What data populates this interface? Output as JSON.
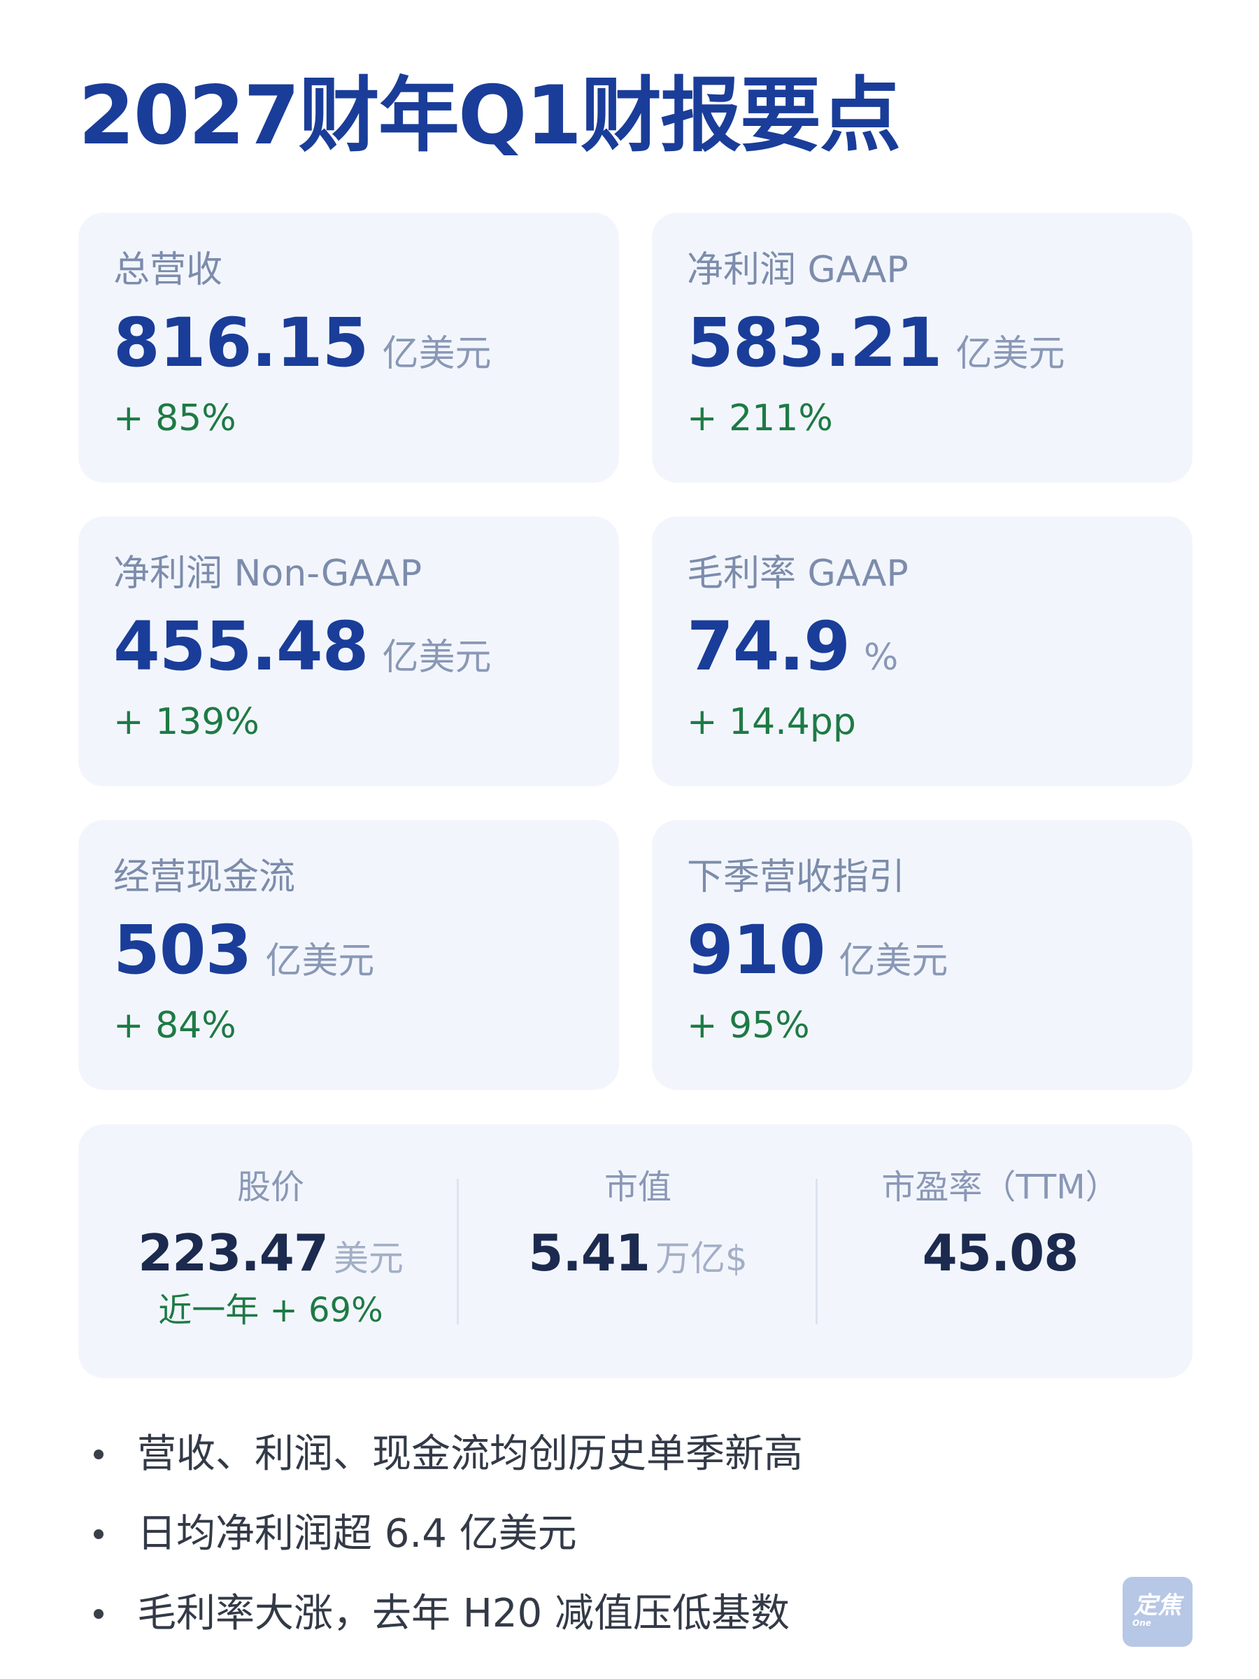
{
  "title": "2027财年Q1财报要点",
  "cards": [
    {
      "label": "总营收",
      "value": "816.15",
      "unit": "亿美元",
      "change": "+ 85%"
    },
    {
      "label": "净利润 GAAP",
      "value": "583.21",
      "unit": "亿美元",
      "change": "+ 211%"
    },
    {
      "label": "净利润 Non-GAAP",
      "value": "455.48",
      "unit": "亿美元",
      "change": "+ 139%"
    },
    {
      "label": "毛利率 GAAP",
      "value": "74.9",
      "unit": "%",
      "change": "+ 14.4pp"
    },
    {
      "label": "经营现金流",
      "value": "503",
      "unit": "亿美元",
      "change": "+ 84%"
    },
    {
      "label": "下季营收指引",
      "value": "910",
      "unit": "亿美元",
      "change": "+ 95%"
    }
  ],
  "stats": {
    "price": {
      "label": "股价",
      "value": "223.47",
      "unit": "美元",
      "sub": "近一年 + 69%"
    },
    "market_cap": {
      "label": "市值",
      "value": "5.41",
      "unit": "万亿$"
    },
    "pe": {
      "label": "市盈率（TTM）",
      "value": "45.08"
    }
  },
  "bullets": [
    "营收、利润、现金流均创历史单季新高",
    "日均净利润超 6.4 亿美元",
    "毛利率大涨，去年 H20 减值压低基数"
  ],
  "logo": {
    "main": "定焦",
    "sub": "One"
  },
  "colors": {
    "title": "#1a3d99",
    "value": "#1a3d99",
    "positive": "#1e7a45",
    "card_bg": "#f2f6fc",
    "label": "#7d8cab"
  }
}
